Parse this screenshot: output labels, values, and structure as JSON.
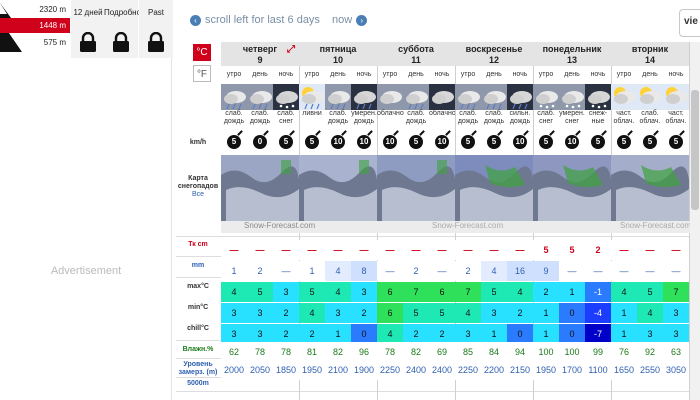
{
  "elevation": {
    "top": "2320 m",
    "mid": "1448 m",
    "bottom": "575 m"
  },
  "locked_tabs": [
    "12 дней",
    "Подробно",
    "Past"
  ],
  "advert": "Advertisement",
  "nav": {
    "scroll_left": "scroll left for last 6 days",
    "now": "now",
    "view": "vie"
  },
  "units": {
    "c": "°C",
    "f": "°F"
  },
  "row_labels": {
    "wind": "km/h",
    "snowmap": "Карта снегопадов",
    "snowmap_all": "Все",
    "snow": "Тк cm",
    "rain": "mm",
    "max": "max°C",
    "min": "min°C",
    "chill": "chill°C",
    "humidity": "Влажн.%",
    "freezing": "Уровень замерз. (m)",
    "level5000": "5000m"
  },
  "credit": "Snow-Forecast.com",
  "colors": {
    "red": "#d0021b",
    "blue": "#2f5fb0"
  },
  "days": [
    {
      "name": "четверг",
      "num": "9",
      "periods": [
        "утро",
        "день",
        "ночь"
      ],
      "weather": [
        "слаб. дождь",
        "слаб. дождь",
        "слаб. снег"
      ],
      "wind": [
        "5",
        "0",
        "5"
      ],
      "snow": [
        "—",
        "—",
        "—"
      ],
      "rain": [
        "1",
        "2",
        "—"
      ],
      "max": [
        "4",
        "5",
        "3"
      ],
      "min": [
        "3",
        "3",
        "2"
      ],
      "chill": [
        "3",
        "3",
        "2"
      ],
      "humidity": [
        "62",
        "78",
        "78"
      ],
      "freezing": [
        "2000",
        "2050",
        "1850"
      ]
    },
    {
      "name": "пятница",
      "num": "10",
      "periods": [
        "утро",
        "день",
        "ночь"
      ],
      "weather": [
        "ливни",
        "слаб. дождь",
        "умерен. дождь"
      ],
      "wind": [
        "5",
        "10",
        "10"
      ],
      "snow": [
        "—",
        "—",
        "—"
      ],
      "rain": [
        "1",
        "4",
        "8"
      ],
      "max": [
        "5",
        "4",
        "3"
      ],
      "min": [
        "4",
        "3",
        "2"
      ],
      "chill": [
        "2",
        "1",
        "0"
      ],
      "humidity": [
        "81",
        "82",
        "96"
      ],
      "freezing": [
        "1950",
        "2100",
        "1900"
      ]
    },
    {
      "name": "суббота",
      "num": "11",
      "periods": [
        "утро",
        "день",
        "ночь"
      ],
      "weather": [
        "облачно",
        "слаб. дождь",
        "облачно"
      ],
      "wind": [
        "10",
        "5",
        "10"
      ],
      "snow": [
        "—",
        "—",
        "—"
      ],
      "rain": [
        "—",
        "2",
        "—"
      ],
      "max": [
        "6",
        "7",
        "6"
      ],
      "min": [
        "6",
        "5",
        "5"
      ],
      "chill": [
        "4",
        "2",
        "2"
      ],
      "humidity": [
        "78",
        "82",
        "69"
      ],
      "freezing": [
        "2250",
        "2400",
        "2400"
      ]
    },
    {
      "name": "воскресенье",
      "num": "12",
      "periods": [
        "утро",
        "день",
        "ночь"
      ],
      "weather": [
        "слаб. дождь",
        "слаб. дождь",
        "сильн. дождь"
      ],
      "wind": [
        "5",
        "5",
        "10"
      ],
      "snow": [
        "—",
        "—",
        "—"
      ],
      "rain": [
        "2",
        "4",
        "16"
      ],
      "max": [
        "7",
        "5",
        "4"
      ],
      "min": [
        "4",
        "3",
        "2"
      ],
      "chill": [
        "3",
        "1",
        "0"
      ],
      "humidity": [
        "85",
        "84",
        "94"
      ],
      "freezing": [
        "2250",
        "2200",
        "2150"
      ]
    },
    {
      "name": "понедельник",
      "num": "13",
      "periods": [
        "утро",
        "день",
        "ночь"
      ],
      "weather": [
        "слаб. снег",
        "умерен. снег",
        "снеж- ные"
      ],
      "wind": [
        "5",
        "10",
        "5"
      ],
      "snow": [
        "5",
        "5",
        "2"
      ],
      "rain": [
        "9",
        "—",
        "—"
      ],
      "max": [
        "2",
        "1",
        "-1"
      ],
      "min": [
        "1",
        "0",
        "-4"
      ],
      "chill": [
        "1",
        "0",
        "-7"
      ],
      "humidity": [
        "100",
        "100",
        "99"
      ],
      "freezing": [
        "1950",
        "1700",
        "1100"
      ]
    },
    {
      "name": "вторник",
      "num": "14",
      "periods": [
        "утро",
        "день",
        "ночь"
      ],
      "weather": [
        "част. облач.",
        "слаб. облач.",
        "част. облач."
      ],
      "wind": [
        "5",
        "5",
        "5"
      ],
      "snow": [
        "—",
        "—",
        "—"
      ],
      "rain": [
        "—",
        "—",
        "—"
      ],
      "max": [
        "4",
        "5",
        "7"
      ],
      "min": [
        "1",
        "4",
        "3"
      ],
      "chill": [
        "1",
        "3",
        "3"
      ],
      "humidity": [
        "76",
        "92",
        "63"
      ],
      "freezing": [
        "1650",
        "2550",
        "3050"
      ]
    }
  ]
}
